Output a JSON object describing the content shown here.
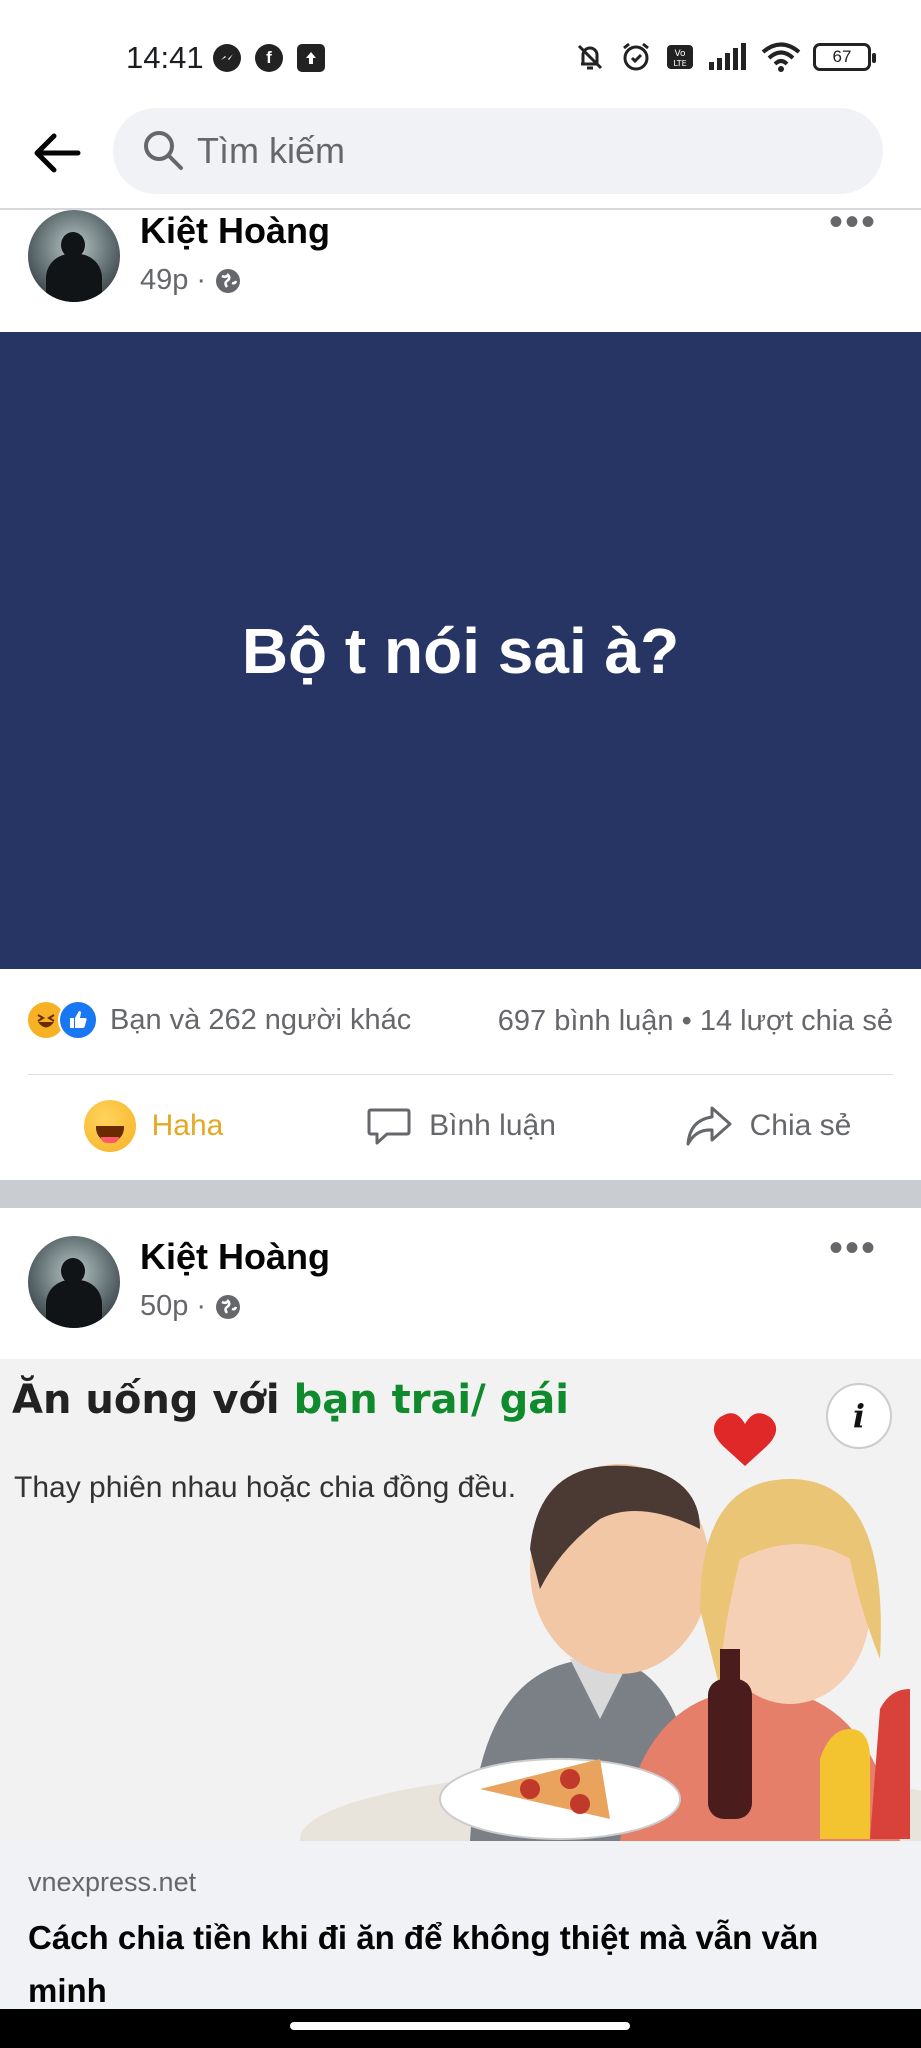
{
  "status_bar": {
    "time": "14:41",
    "left_icons": [
      "messenger-icon",
      "facebook-icon",
      "upload-icon"
    ],
    "right_icons": [
      "bell-off-icon",
      "alarm-icon",
      "volte-icon",
      "signal-icon",
      "wifi-icon"
    ],
    "battery": "67"
  },
  "search": {
    "placeholder": "Tìm kiếm"
  },
  "posts": [
    {
      "author": "Kiệt Hoàng",
      "time": "49p",
      "meta_sep": "·",
      "body_text": "Bộ t nói sai à?",
      "background_color": "#263563",
      "reactions_text": "Bạn và 262 người khác",
      "comments_text": "697 bình luận",
      "stats_sep": "•",
      "shares_text": "14 lượt chia sẻ",
      "actions": {
        "reaction": "Haha",
        "comment": "Bình luận",
        "share": "Chia sẻ"
      }
    },
    {
      "author": "Kiệt Hoàng",
      "time": "50p",
      "meta_sep": "·",
      "link": {
        "image_title_prefix": "Ăn uống với",
        "image_title_highlight": "bạn trai/ gái",
        "image_subtitle": "Thay phiên nhau hoặc chia đồng đều.",
        "info_label": "i",
        "domain": "vnexpress.net",
        "headline": "Cách chia tiền khi đi ăn để không thiệt mà vẫn văn minh"
      }
    }
  ],
  "colors": {
    "accent": "#1877f2",
    "haha": "#e5a823",
    "text_secondary": "#65676b"
  }
}
